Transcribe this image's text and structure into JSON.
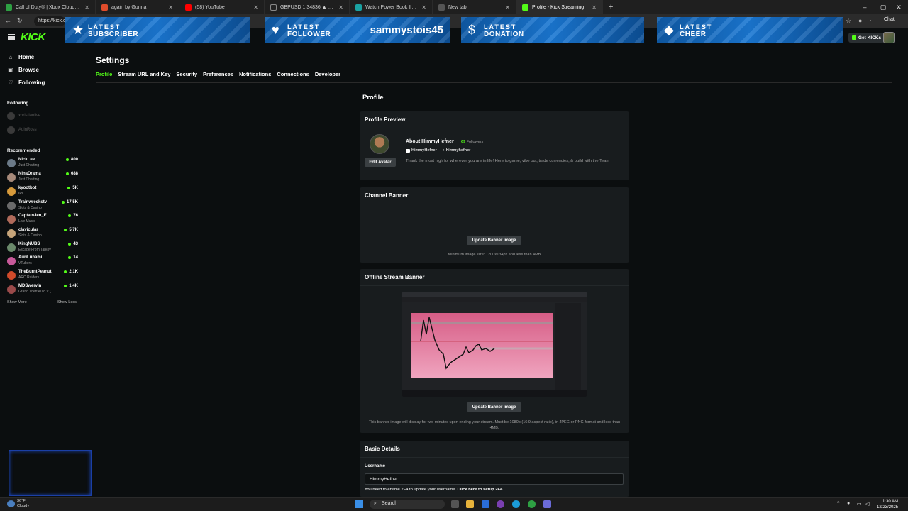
{
  "browser": {
    "tabs": [
      {
        "label": "Call of Duty® | Xbox Cloud Gaming",
        "color": "#2ea043"
      },
      {
        "label": "again by Gunna",
        "color": "#e04c2b"
      },
      {
        "label": "(58) YouTube",
        "color": "#ff0000"
      },
      {
        "label": "GBPUSD 1.34836 ▲ +0.2% Unnamed",
        "color": "#222222"
      },
      {
        "label": "Watch Power Book III: Raising Kanan",
        "color": "#1aa2a2"
      },
      {
        "label": "New tab",
        "color": "#555555"
      },
      {
        "label": "Profile - Kick Streaming",
        "color": "#53fc18"
      }
    ],
    "new_tab": "+",
    "address": "https://kick.com",
    "chat_label": "Chat",
    "window_controls": [
      "–",
      "▢",
      "✕"
    ]
  },
  "alerts": [
    {
      "line1": "LATEST",
      "line2": "SUBSCRIBER",
      "icon": "★"
    },
    {
      "line1": "LATEST",
      "line2": "FOLLOWER",
      "icon": "♥",
      "name": "sammystois45"
    },
    {
      "line1": "LATEST",
      "line2": "DONATION",
      "icon": "$"
    },
    {
      "line1": "LATEST",
      "line2": "CHEER",
      "icon": "◆"
    }
  ],
  "header": {
    "logo": "KICK",
    "get_kicks": "Get KICKs"
  },
  "sidebar": {
    "nav": [
      {
        "label": "Home",
        "icon": "⌂"
      },
      {
        "label": "Browse",
        "icon": "▣"
      },
      {
        "label": "Following",
        "icon": "♡"
      }
    ],
    "following_title": "Following",
    "following": [
      "xhristianlive",
      "AdinRoss"
    ],
    "recommended_title": "Recommended",
    "recommended": [
      {
        "name": "NickLee",
        "category": "Just Chatting",
        "viewers": "800",
        "color": "#6b7a88"
      },
      {
        "name": "NinaDrama",
        "category": "Just Chatting",
        "viewers": "688",
        "color": "#a78a7a"
      },
      {
        "name": "kyootbot",
        "category": "IRL",
        "viewers": "5K",
        "color": "#d69a3b"
      },
      {
        "name": "Trainwreckstv",
        "category": "Slots & Casino",
        "viewers": "17.5K",
        "color": "#6a6a6a"
      },
      {
        "name": "CaptainJen_E",
        "category": "Live Music",
        "viewers": "76",
        "color": "#b06a5a"
      },
      {
        "name": "clavicular",
        "category": "Slots & Casino",
        "viewers": "5.7K",
        "color": "#c7a57a"
      },
      {
        "name": "KingNUBS",
        "category": "Escape From Tarkov",
        "viewers": "43",
        "color": "#6b8a6b"
      },
      {
        "name": "AuriLunami",
        "category": "VTubers",
        "viewers": "14",
        "color": "#c85a9a"
      },
      {
        "name": "TheBurntPeanut",
        "category": "ARC Raiders",
        "viewers": "2.1K",
        "color": "#d04a2a"
      },
      {
        "name": "MDSwervin",
        "category": "Grand Theft Auto V (...",
        "viewers": "1.4K",
        "color": "#9a4a4a"
      }
    ],
    "show_more": "Show More",
    "show_less": "Show Less"
  },
  "settings": {
    "title": "Settings",
    "tabs": [
      "Profile",
      "Stream URL and Key",
      "Security",
      "Preferences",
      "Notifications",
      "Connections",
      "Developer"
    ],
    "section_title": "Profile",
    "preview": {
      "title": "Profile Preview",
      "about": "About HimmyHefner",
      "followers_count": "69",
      "followers_label": "Followers",
      "social1": "HimmyHefner",
      "social2": "himmyhefner",
      "bio": "Thank the most high for wherever you are in life! Here to game, vibe out, trade currencies, & build with the Team",
      "edit_avatar": "Edit Avatar"
    },
    "channel_banner": {
      "title": "Channel Banner",
      "button": "Update Banner image",
      "note": "Minimum image size: 1200×134px and less than 4MB"
    },
    "offline_banner": {
      "title": "Offline Stream Banner",
      "button": "Update Banner image",
      "note": "This banner image will display for two minutes upon ending your stream. Must be 1080p (16:9 aspect ratio), in JPEG or PNG format and less than 4MB."
    },
    "basic": {
      "title": "Basic Details",
      "username_label": "Username",
      "username_value": "HimmyHefner",
      "twofa_note": "You need to enable 2FA to update your username.",
      "twofa_link": "Click here to setup 2FA."
    }
  },
  "taskbar": {
    "weather_temp": "36°F",
    "weather_desc": "Cloudy",
    "search": "Search",
    "time": "1:30 AM",
    "date": "12/23/2025"
  }
}
